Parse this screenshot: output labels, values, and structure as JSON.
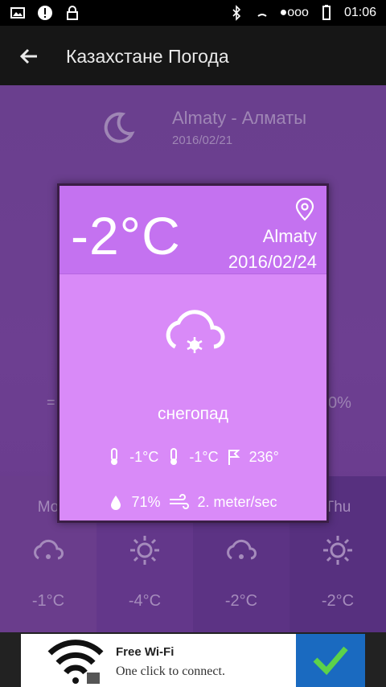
{
  "status_bar": {
    "time": "01:06",
    "signal": "●ooo"
  },
  "toolbar": {
    "title": "Казахстане Погода"
  },
  "background": {
    "city": "Almaty - Алматы",
    "date": "2016/02/21",
    "left_partial": "=",
    "right_partial": "0%"
  },
  "forecast": [
    {
      "name": "Mo",
      "temp": "-1°C",
      "icon": "cloud-snow-icon"
    },
    {
      "name": "",
      "temp": "-4°C",
      "icon": "sun-icon"
    },
    {
      "name": "",
      "temp": "-2°C",
      "icon": "cloud-snow-icon"
    },
    {
      "name": "Thu",
      "temp": "-2°C",
      "icon": "sun-icon"
    }
  ],
  "dialog": {
    "temp": "-2°C",
    "city": "Almaty",
    "date": "2016/02/24",
    "description": "снегопад",
    "temp_min": "-1°C",
    "temp_max": "-1°C",
    "wind_deg": "236°",
    "humidity": "71%",
    "wind_speed": "2. meter/sec"
  },
  "ad": {
    "title": "Free Wi-Fi",
    "subtitle": "One click to connect."
  },
  "colors": {
    "accent": "#c472f0",
    "dialog_bg": "#d98af8",
    "app_bg": "#6a3f8e"
  }
}
